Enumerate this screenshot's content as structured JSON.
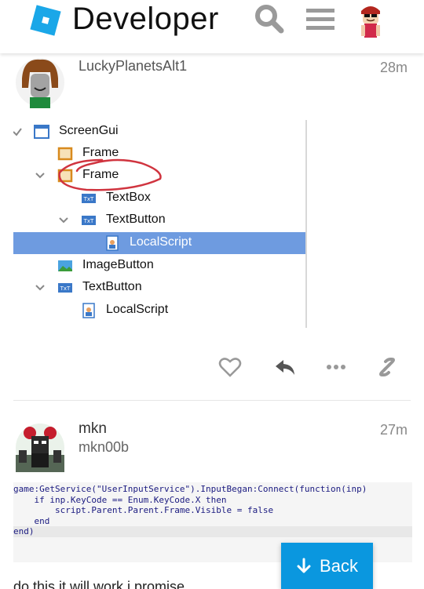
{
  "header": {
    "brand": "Developer"
  },
  "post1": {
    "username": "LuckyPlanetsAlt1",
    "time": "28m",
    "explorer_rows": [
      {
        "label": "ScreenGui",
        "icon": "screengui-icon"
      },
      {
        "label": "Frame",
        "icon": "frame-icon"
      },
      {
        "label": "Frame",
        "icon": "frame-icon"
      },
      {
        "label": "TextBox",
        "icon": "textbox-icon"
      },
      {
        "label": "TextButton",
        "icon": "textbutton-icon"
      },
      {
        "label": "LocalScript",
        "icon": "localscript-icon"
      },
      {
        "label": "ImageButton",
        "icon": "imagebutton-icon"
      },
      {
        "label": "TextButton",
        "icon": "textbutton-icon"
      },
      {
        "label": "LocalScript",
        "icon": "localscript-icon"
      }
    ],
    "selected_row": "LocalScript",
    "annotation_color": "#d0343f"
  },
  "post2": {
    "username": "mkn",
    "handle": "mkn00b",
    "time": "27m",
    "code_lines": [
      "game:GetService(\"UserInputService\").InputBegan:Connect(function(inp)",
      "    if inp.KeyCode == Enum.KeyCode.X then",
      "        script.Parent.Parent.Frame.Visible = false",
      "    end",
      "end)"
    ],
    "text": "do this it will work i promise"
  },
  "back_button": {
    "label": "Back"
  },
  "colors": {
    "accent": "#0a97df",
    "selection": "#6e9be0"
  }
}
